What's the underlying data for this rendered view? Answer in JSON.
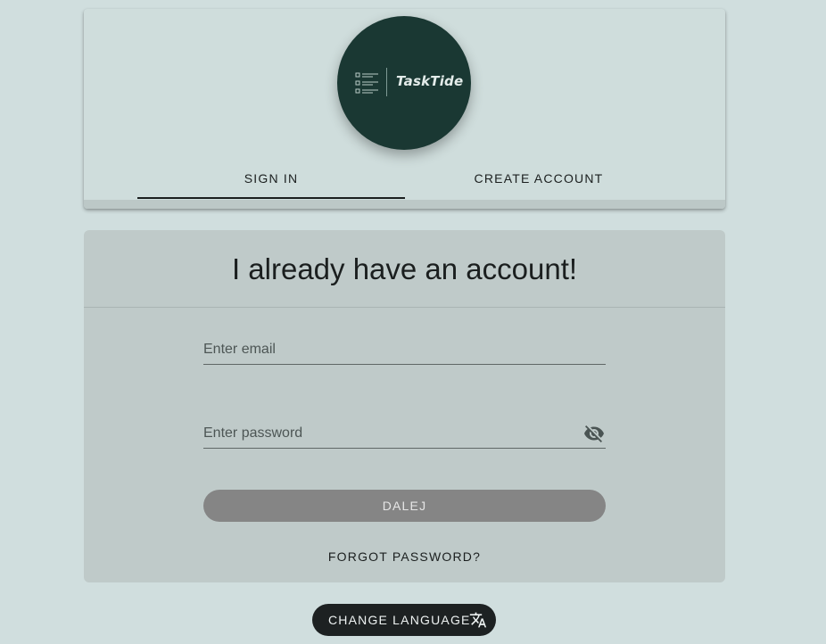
{
  "app": {
    "logo_text": "TaskTide"
  },
  "tabs": [
    {
      "label": "SIGN IN",
      "active": true
    },
    {
      "label": "CREATE ACCOUNT",
      "active": false
    }
  ],
  "form": {
    "title": "I already have an account!",
    "email": {
      "placeholder": "Enter email",
      "value": ""
    },
    "password": {
      "placeholder": "Enter password",
      "value": "",
      "toggle_icon": "visibility-off-icon"
    },
    "submit_label": "DALEJ",
    "forgot_label": "FORGOT PASSWORD?"
  },
  "footer": {
    "change_language_label": "CHANGE LANGUAGE",
    "language_icon": "translate-icon"
  },
  "colors": {
    "page_bg": "#d0dede",
    "logo_bg": "#1a3833",
    "form_bg": "#bfcac9",
    "submit_disabled": "#858585",
    "language_button": "#1d2122"
  }
}
